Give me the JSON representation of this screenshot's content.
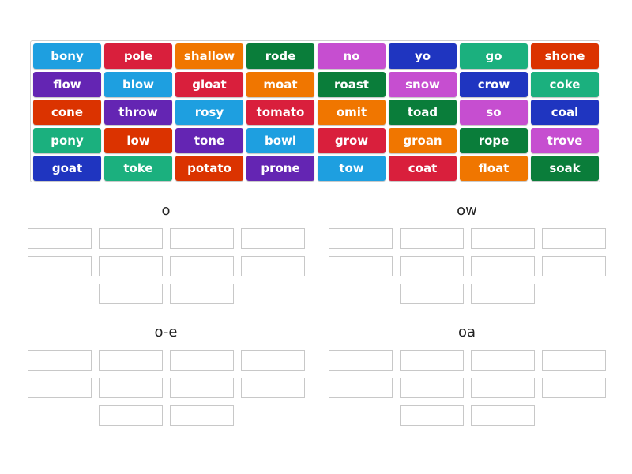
{
  "colors": {
    "light_blue": "#1e9fe0",
    "crimson": "#d91f3c",
    "orange": "#f07600",
    "dark_green": "#0a7d3a",
    "magenta": "#c64ed0",
    "dark_blue": "#1f35c0",
    "teal": "#1bb07e",
    "red_orange": "#db3300",
    "purple": "#6425b3"
  },
  "tiles": [
    {
      "word": "bony",
      "color": "light_blue"
    },
    {
      "word": "pole",
      "color": "crimson"
    },
    {
      "word": "shallow",
      "color": "orange"
    },
    {
      "word": "rode",
      "color": "dark_green"
    },
    {
      "word": "no",
      "color": "magenta"
    },
    {
      "word": "yo",
      "color": "dark_blue"
    },
    {
      "word": "go",
      "color": "teal"
    },
    {
      "word": "shone",
      "color": "red_orange"
    },
    {
      "word": "flow",
      "color": "purple"
    },
    {
      "word": "blow",
      "color": "light_blue"
    },
    {
      "word": "gloat",
      "color": "crimson"
    },
    {
      "word": "moat",
      "color": "orange"
    },
    {
      "word": "roast",
      "color": "dark_green"
    },
    {
      "word": "snow",
      "color": "magenta"
    },
    {
      "word": "crow",
      "color": "dark_blue"
    },
    {
      "word": "coke",
      "color": "teal"
    },
    {
      "word": "cone",
      "color": "red_orange"
    },
    {
      "word": "throw",
      "color": "purple"
    },
    {
      "word": "rosy",
      "color": "light_blue"
    },
    {
      "word": "tomato",
      "color": "crimson"
    },
    {
      "word": "omit",
      "color": "orange"
    },
    {
      "word": "toad",
      "color": "dark_green"
    },
    {
      "word": "so",
      "color": "magenta"
    },
    {
      "word": "coal",
      "color": "dark_blue"
    },
    {
      "word": "pony",
      "color": "teal"
    },
    {
      "word": "low",
      "color": "red_orange"
    },
    {
      "word": "tone",
      "color": "purple"
    },
    {
      "word": "bowl",
      "color": "light_blue"
    },
    {
      "word": "grow",
      "color": "crimson"
    },
    {
      "word": "groan",
      "color": "orange"
    },
    {
      "word": "rope",
      "color": "dark_green"
    },
    {
      "word": "trove",
      "color": "magenta"
    },
    {
      "word": "goat",
      "color": "dark_blue"
    },
    {
      "word": "toke",
      "color": "teal"
    },
    {
      "word": "potato",
      "color": "red_orange"
    },
    {
      "word": "prone",
      "color": "purple"
    },
    {
      "word": "tow",
      "color": "light_blue"
    },
    {
      "word": "coat",
      "color": "crimson"
    },
    {
      "word": "float",
      "color": "orange"
    },
    {
      "word": "soak",
      "color": "dark_green"
    }
  ],
  "groups": [
    {
      "id": "o",
      "title": "o",
      "slot_count": 10
    },
    {
      "id": "ow",
      "title": "ow",
      "slot_count": 10
    },
    {
      "id": "oe",
      "title": "o-e",
      "slot_count": 10
    },
    {
      "id": "oa",
      "title": "oa",
      "slot_count": 10
    }
  ]
}
